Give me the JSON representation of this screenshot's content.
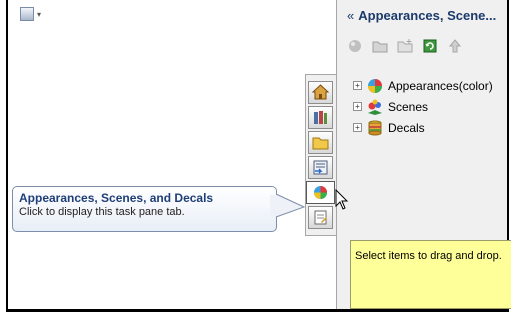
{
  "pane": {
    "title": "Appearances, Scene...",
    "collapse_glyph": "«",
    "tools": [
      "sphere-icon",
      "open-folder-icon",
      "new-folder-icon",
      "refresh-icon",
      "up-arrow-icon"
    ]
  },
  "tree": {
    "items": [
      {
        "label": "Appearances(color)",
        "icon": "appearance-ball-icon"
      },
      {
        "label": "Scenes",
        "icon": "scene-icon"
      },
      {
        "label": "Decals",
        "icon": "decal-stack-icon"
      }
    ]
  },
  "hint": {
    "text": "Select items to drag and drop."
  },
  "tooltip": {
    "title": "Appearances, Scenes, and Decals",
    "body": "Click to display this task pane tab."
  },
  "tabs": [
    "home-icon",
    "design-library-icon",
    "file-explorer-icon",
    "view-palette-icon",
    "appearances-icon",
    "custom-properties-icon"
  ],
  "colors": {
    "title_text": "#1b3a6b",
    "hint_bg": "#ffff99",
    "tooltip_title": "#1f3f78"
  }
}
